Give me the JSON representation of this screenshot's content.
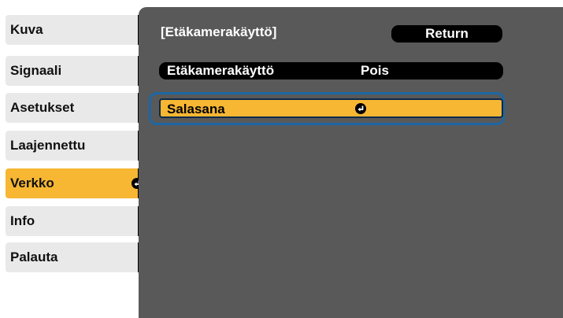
{
  "sidebar": {
    "items": [
      {
        "label": "Kuva"
      },
      {
        "label": "Signaali"
      },
      {
        "label": "Asetukset"
      },
      {
        "label": "Laajennettu"
      },
      {
        "label": "Verkko",
        "active": true,
        "icon": "enter-icon"
      },
      {
        "label": "Info"
      },
      {
        "label": "Palauta"
      }
    ]
  },
  "panel": {
    "title": "[Etäkamerakäyttö]",
    "return_label": "Return",
    "rows": [
      {
        "label": "Etäkamerakäyttö",
        "value": "Pois"
      },
      {
        "label": "Salasana",
        "icon": "enter-icon",
        "selected": true
      }
    ]
  },
  "colors": {
    "highlight": "#f7b733",
    "panel_bg": "#595959",
    "selection_frame": "#1c67a5"
  }
}
